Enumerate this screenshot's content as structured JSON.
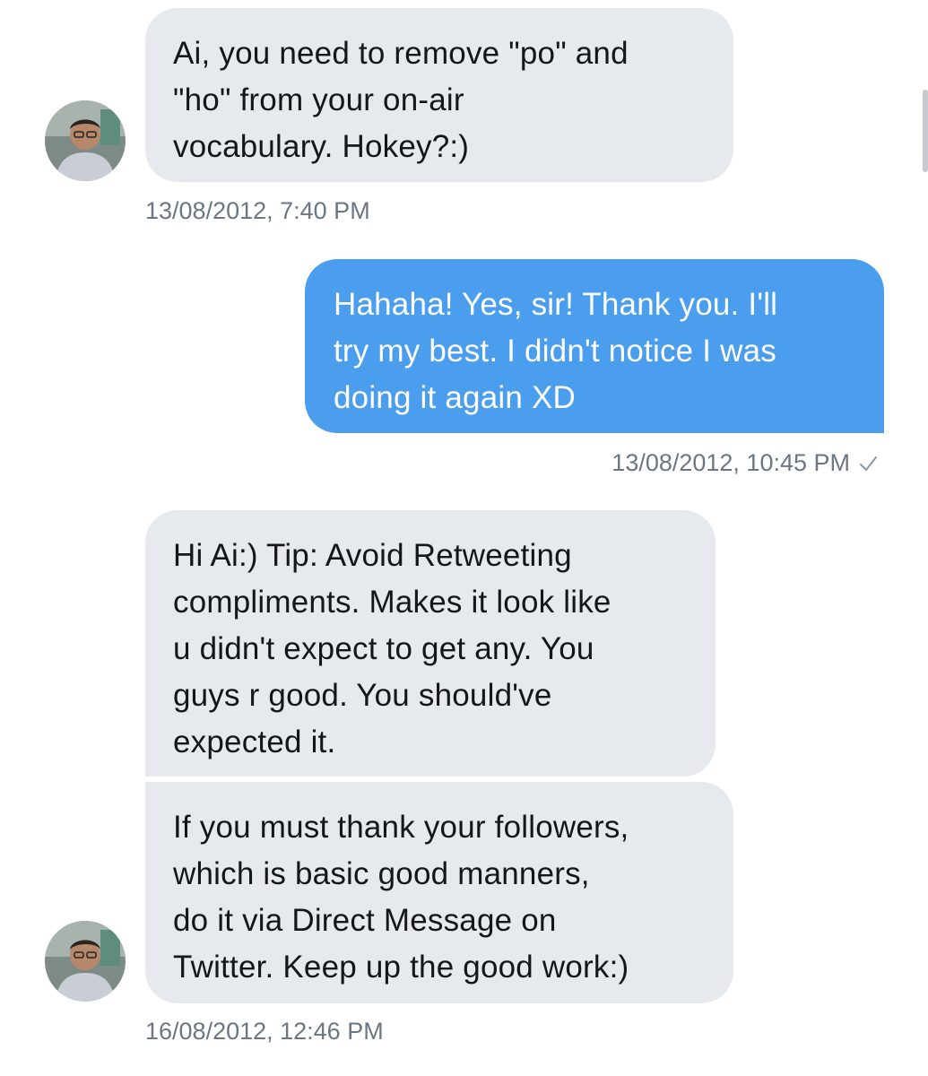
{
  "messages": [
    {
      "direction": "incoming",
      "lines": [
        "Ai, you need to remove \"po\" and",
        "\"ho\" from your on-air",
        "vocabulary. Hokey?:)"
      ],
      "timestamp": "13/08/2012, 7:40 PM"
    },
    {
      "direction": "outgoing",
      "lines": [
        "Hahaha! Yes, sir! Thank you. I'll",
        "try my best. I didn't notice I was",
        "doing it again XD"
      ],
      "timestamp": "13/08/2012, 10:45 PM",
      "status_icon": "checkmark-icon"
    },
    {
      "direction": "incoming",
      "lines": [
        "Hi Ai:) Tip: Avoid Retweeting",
        "compliments. Makes it look like",
        "u didn't expect to get any. You",
        "guys r good. You should've",
        "expected it."
      ]
    },
    {
      "direction": "incoming",
      "lines": [
        "If you must thank your followers,",
        "which is basic good manners,",
        "do it via Direct Message on",
        "Twitter. Keep up the good work:)"
      ],
      "timestamp": "16/08/2012, 12:46 PM"
    }
  ],
  "colors": {
    "incoming_bubble": "#e6e9ee",
    "outgoing_bubble": "#4a9eed",
    "timestamp_text": "#6b7684"
  }
}
